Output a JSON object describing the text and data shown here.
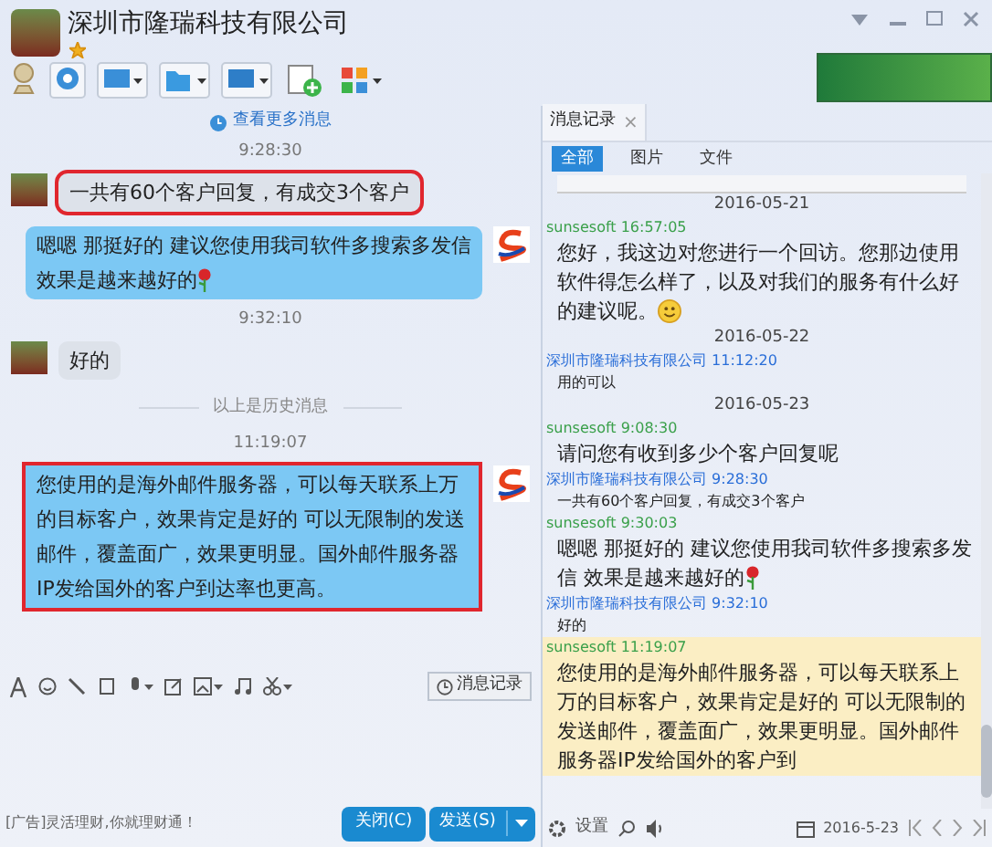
{
  "header": {
    "title": "深圳市隆瑞科技有限公司",
    "starred": true
  },
  "chat": {
    "more_link": "查看更多消息",
    "items": [
      {
        "kind": "time",
        "text": "9:28:30"
      },
      {
        "kind": "incoming",
        "text": "一共有60个客户回复，有成交3个客户",
        "highlighted": true,
        "rose": false
      },
      {
        "kind": "outgoing",
        "text": "嗯嗯 那挺好的 建议您使用我司软件多搜索多发信效果是越来越好的",
        "highlighted": false,
        "rose": true
      },
      {
        "kind": "time",
        "text": "9:32:10"
      },
      {
        "kind": "incoming",
        "text": "好的",
        "highlighted": false,
        "rose": false
      },
      {
        "kind": "divider",
        "text": "以上是历史消息"
      },
      {
        "kind": "time",
        "text": "11:19:07"
      },
      {
        "kind": "outgoing",
        "text": "您使用的是海外邮件服务器，可以每天联系上万的目标客户，效果肯定是好的 可以无限制的发送邮件，覆盖面广，效果更明显。国外邮件服务器IP发给国外的客户到达率也更高。",
        "highlighted": true,
        "rose": false
      }
    ]
  },
  "input": {
    "history_button": "消息记录",
    "ad": "[广告]灵活理财,你就理财通！",
    "buttons": [
      "关闭(C)",
      "发送(S)"
    ]
  },
  "history": {
    "tab": "消息记录",
    "close": "×",
    "subtabs": [
      {
        "label": "全部",
        "selected": true
      },
      {
        "label": "图片",
        "selected": false
      },
      {
        "label": "文件",
        "selected": false
      }
    ],
    "entries": [
      {
        "kind": "date",
        "text": "2016-05-21"
      },
      {
        "kind": "outgoing",
        "sender": "sunsesoft",
        "time": "16:57:05",
        "text": "您好，我这边对您进行一个回访。您那边使用软件得怎么样了，以及对我们的服务有什么好的建议呢。",
        "smiley": true,
        "rose": false,
        "highlighted": false
      },
      {
        "kind": "date",
        "text": "2016-05-22"
      },
      {
        "kind": "incoming",
        "sender": "深圳市隆瑞科技有限公司",
        "time": "11:12:20",
        "text": "用的可以",
        "smiley": false,
        "rose": false,
        "highlighted": false
      },
      {
        "kind": "date",
        "text": "2016-05-23"
      },
      {
        "kind": "outgoing",
        "sender": "sunsesoft",
        "time": "9:08:30",
        "text": "请问您有收到多少个客户回复呢",
        "smiley": false,
        "rose": false,
        "highlighted": false
      },
      {
        "kind": "incoming",
        "sender": "深圳市隆瑞科技有限公司",
        "time": "9:28:30",
        "text": "一共有60个客户回复，有成交3个客户",
        "smiley": false,
        "rose": false,
        "highlighted": false
      },
      {
        "kind": "outgoing",
        "sender": "sunsesoft",
        "time": "9:30:03",
        "text": "嗯嗯 那挺好的 建议您使用我司软件多搜索多发信 效果是越来越好的",
        "smiley": false,
        "rose": true,
        "highlighted": false
      },
      {
        "kind": "incoming",
        "sender": "深圳市隆瑞科技有限公司",
        "time": "9:32:10",
        "text": "好的",
        "smiley": false,
        "rose": false,
        "highlighted": false
      },
      {
        "kind": "outgoing",
        "sender": "sunsesoft",
        "time": "11:19:07",
        "text": "您使用的是海外邮件服务器，可以每天联系上万的目标客户，效果肯定是好的 可以无限制的发送邮件，覆盖面广，效果更明显。国外邮件服务器IP发给国外的客户到",
        "smiley": false,
        "rose": false,
        "highlighted": true
      }
    ],
    "settings": "设置",
    "date": "2016-5-23"
  }
}
